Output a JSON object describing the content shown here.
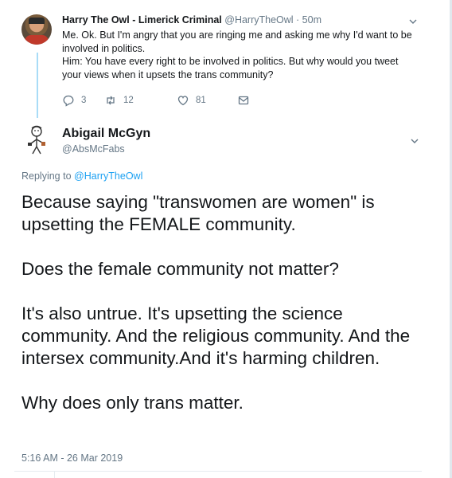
{
  "parent_tweet": {
    "name": "Harry The Owl - Limerick Criminal",
    "handle": "@HarryTheOwl",
    "time": "· 50m",
    "body": [
      "Me. Ok. But I'm angry that you are ringing me and asking me why I'd want to be involved in politics.",
      "Him: You have every right to be involved in politics. But why would you tweet your views when it upsets the trans community?"
    ],
    "actions": {
      "reply_count": "3",
      "retweet_count": "12",
      "like_count": "81"
    }
  },
  "main_tweet": {
    "name": "Abigail McGyn",
    "handle": "@AbsMcFabs",
    "replying_label": "Replying to",
    "replying_handle": "@HarryTheOwl",
    "body": "Because saying \"transwomen are women\" is upsetting the FEMALE community.\n\nDoes the female community not matter?\n\nIt's also untrue. It's upsetting the science community. And the religious community. And the intersex community.And it's harming children.\n\nWhy does only trans matter.",
    "timestamp": "5:16 AM - 26 Mar 2019"
  },
  "icons": [
    "chevron-down-icon",
    "reply-icon",
    "retweet-icon",
    "like-icon",
    "direct-message-icon"
  ],
  "colors": {
    "thread_line": "#a9dcf7",
    "link": "#1da1f2",
    "secondary_text": "#657786",
    "primary_text": "#14171a"
  }
}
